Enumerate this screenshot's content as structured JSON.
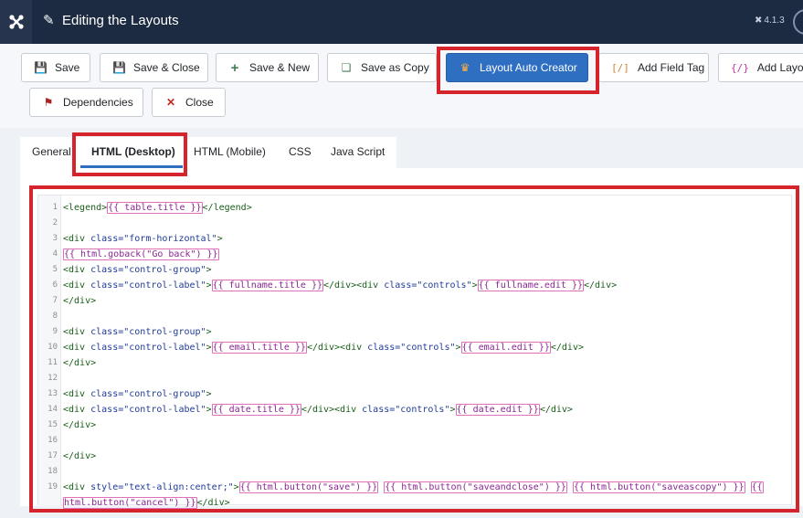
{
  "header": {
    "title": "Editing the Layouts",
    "version": "4.1.3",
    "logo_icon": "joomla-logo-icon",
    "title_icon": "pencil-icon"
  },
  "toolbar": {
    "save": "Save",
    "save_close": "Save & Close",
    "save_new": "Save & New",
    "save_copy": "Save as Copy",
    "layout_auto_creator": "Layout Auto Creator",
    "add_field_tag": "Add Field Tag",
    "add_layout": "Add Layou",
    "dependencies": "Dependencies",
    "close": "Close"
  },
  "tabs": {
    "general": "General",
    "html_desktop": "HTML (Desktop)",
    "html_mobile": "HTML (Mobile)",
    "css": "CSS",
    "javascript": "Java Script",
    "active": "HTML (Desktop)"
  },
  "editor": {
    "lines": [
      {
        "n": "1",
        "tokens": [
          [
            "tg",
            "<legend>"
          ],
          [
            "pl",
            "{{ table.title }}"
          ],
          [
            "tg",
            "</legend>"
          ]
        ]
      },
      {
        "n": "2",
        "tokens": []
      },
      {
        "n": "3",
        "tokens": [
          [
            "tg",
            "<div "
          ],
          [
            "at",
            "class="
          ],
          [
            "av",
            "\"form-horizontal\""
          ],
          [
            "tg",
            ">"
          ]
        ]
      },
      {
        "n": "4",
        "tokens": [
          [
            "pl",
            "{{ html.goback(\"Go back\") }}"
          ]
        ]
      },
      {
        "n": "5",
        "tokens": [
          [
            "tg",
            "<div "
          ],
          [
            "at",
            "class="
          ],
          [
            "av",
            "\"control-group\""
          ],
          [
            "tg",
            ">"
          ]
        ]
      },
      {
        "n": "6",
        "tokens": [
          [
            "tg",
            "<div "
          ],
          [
            "at",
            "class="
          ],
          [
            "av",
            "\"control-label\""
          ],
          [
            "tg",
            ">"
          ],
          [
            "pl",
            "{{ fullname.title }}"
          ],
          [
            "tg",
            "</div><div "
          ],
          [
            "at",
            "class="
          ],
          [
            "av",
            "\"controls\""
          ],
          [
            "tg",
            ">"
          ],
          [
            "pl",
            "{{ fullname.edit }}"
          ],
          [
            "tg",
            "</div>"
          ]
        ]
      },
      {
        "n": "7",
        "tokens": [
          [
            "tg",
            "</div>"
          ]
        ]
      },
      {
        "n": "8",
        "tokens": []
      },
      {
        "n": "9",
        "tokens": [
          [
            "tg",
            "<div "
          ],
          [
            "at",
            "class="
          ],
          [
            "av",
            "\"control-group\""
          ],
          [
            "tg",
            ">"
          ]
        ]
      },
      {
        "n": "10",
        "tokens": [
          [
            "tg",
            "<div "
          ],
          [
            "at",
            "class="
          ],
          [
            "av",
            "\"control-label\""
          ],
          [
            "tg",
            ">"
          ],
          [
            "pl",
            "{{ email.title }}"
          ],
          [
            "tg",
            "</div><div "
          ],
          [
            "at",
            "class="
          ],
          [
            "av",
            "\"controls\""
          ],
          [
            "tg",
            ">"
          ],
          [
            "pl",
            "{{ email.edit }}"
          ],
          [
            "tg",
            "</div>"
          ]
        ]
      },
      {
        "n": "11",
        "tokens": [
          [
            "tg",
            "</div>"
          ]
        ]
      },
      {
        "n": "12",
        "tokens": []
      },
      {
        "n": "13",
        "tokens": [
          [
            "tg",
            "<div "
          ],
          [
            "at",
            "class="
          ],
          [
            "av",
            "\"control-group\""
          ],
          [
            "tg",
            ">"
          ]
        ]
      },
      {
        "n": "14",
        "tokens": [
          [
            "tg",
            "<div "
          ],
          [
            "at",
            "class="
          ],
          [
            "av",
            "\"control-label\""
          ],
          [
            "tg",
            ">"
          ],
          [
            "pl",
            "{{ date.title }}"
          ],
          [
            "tg",
            "</div><div "
          ],
          [
            "at",
            "class="
          ],
          [
            "av",
            "\"controls\""
          ],
          [
            "tg",
            ">"
          ],
          [
            "pl",
            "{{ date.edit }}"
          ],
          [
            "tg",
            "</div>"
          ]
        ]
      },
      {
        "n": "15",
        "tokens": [
          [
            "tg",
            "</div>"
          ]
        ]
      },
      {
        "n": "16",
        "tokens": []
      },
      {
        "n": "17",
        "tokens": [
          [
            "tg",
            "</div>"
          ]
        ]
      },
      {
        "n": "18",
        "tokens": []
      },
      {
        "n": "19",
        "tokens": [
          [
            "tg",
            "<div "
          ],
          [
            "at",
            "style="
          ],
          [
            "av",
            "\"text-align:center;\""
          ],
          [
            "tg",
            ">"
          ],
          [
            "pl",
            "{{ html.button(\"save\") }}"
          ],
          [
            "tx",
            " "
          ],
          [
            "pl",
            "{{ html.button(\"saveandclose\") }}"
          ],
          [
            "tx",
            " "
          ],
          [
            "pl",
            "{{ html.button(\"saveascopy\") }}"
          ],
          [
            "tx",
            " "
          ],
          [
            "pl",
            "{{"
          ]
        ]
      },
      {
        "n": "",
        "tokens": [
          [
            "pl",
            "html.button(\"cancel\") }}"
          ],
          [
            "tg",
            "</div>"
          ]
        ]
      }
    ]
  },
  "colors": {
    "header_bg": "#1c2b42",
    "primary": "#2f6fc2",
    "highlight": "#d5242b",
    "placeholder_text": "#8a2690"
  }
}
